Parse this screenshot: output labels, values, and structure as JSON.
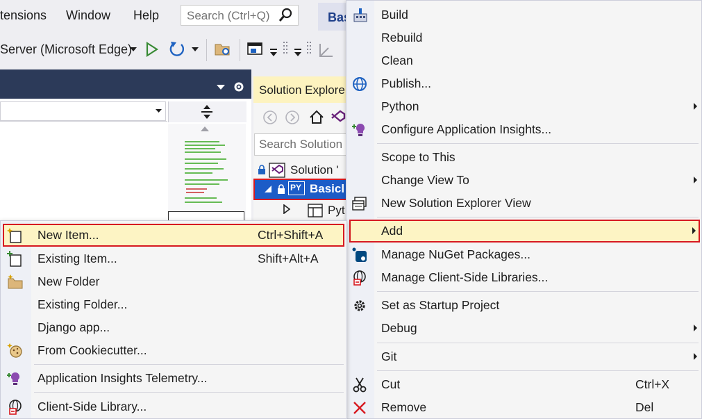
{
  "menubar": {
    "items": [
      "tensions",
      "Window",
      "Help"
    ],
    "search_placeholder": "Search (Ctrl+Q)",
    "solution_tab": "Bas"
  },
  "toolbar": {
    "debug_target": "Server (Microsoft Edge)"
  },
  "solution_explorer": {
    "title": "Solution Explore",
    "search_placeholder": "Search Solution",
    "tree": [
      {
        "label": "Solution '",
        "icon": "solution-icon"
      },
      {
        "label": "Basicl",
        "icon": "python-project-icon",
        "badge": "PY",
        "selected": true
      },
      {
        "label": "Pyt",
        "icon": "python-env-icon"
      }
    ]
  },
  "context_menu": {
    "items": [
      {
        "label": "Build",
        "icon": "build-icon"
      },
      {
        "label": "Rebuild"
      },
      {
        "label": "Clean"
      },
      {
        "label": "Publish...",
        "icon": "globe-icon"
      },
      {
        "label": "Python",
        "submenu": true
      },
      {
        "label": "Configure Application Insights...",
        "icon": "insights-icon"
      },
      {
        "label": "Scope to This"
      },
      {
        "label": "Change View To",
        "submenu": true
      },
      {
        "label": "New Solution Explorer View",
        "icon": "explorer-view-icon"
      },
      {
        "label": "Add",
        "submenu": true,
        "highlighted": true
      },
      {
        "label": "Manage NuGet Packages...",
        "icon": "nuget-icon"
      },
      {
        "label": "Manage Client-Side Libraries...",
        "icon": "client-lib-icon"
      },
      {
        "label": "Set as Startup Project",
        "icon": "gear-icon"
      },
      {
        "label": "Debug",
        "submenu": true
      },
      {
        "label": "Git",
        "submenu": true
      },
      {
        "label": "Cut",
        "shortcut": "Ctrl+X",
        "icon": "scissors-icon"
      },
      {
        "label": "Remove",
        "shortcut": "Del",
        "icon": "remove-icon"
      }
    ]
  },
  "add_submenu": {
    "items": [
      {
        "label": "New Item...",
        "shortcut": "Ctrl+Shift+A",
        "icon": "new-item-icon",
        "highlighted": true
      },
      {
        "label": "Existing Item...",
        "shortcut": "Shift+Alt+A",
        "icon": "existing-item-icon"
      },
      {
        "label": "New Folder",
        "icon": "new-folder-icon"
      },
      {
        "label": "Existing Folder..."
      },
      {
        "label": "Django app..."
      },
      {
        "label": "From Cookiecutter...",
        "icon": "cookiecutter-icon"
      },
      {
        "label": "Application Insights Telemetry...",
        "icon": "insights-icon"
      },
      {
        "label": "Client-Side Library...",
        "icon": "client-lib-icon"
      }
    ]
  },
  "colors": {
    "accent": "#1c5cc7",
    "highlight": "#fdf4c4",
    "outline_red": "#d71920",
    "editor_header": "#2c3a59"
  }
}
